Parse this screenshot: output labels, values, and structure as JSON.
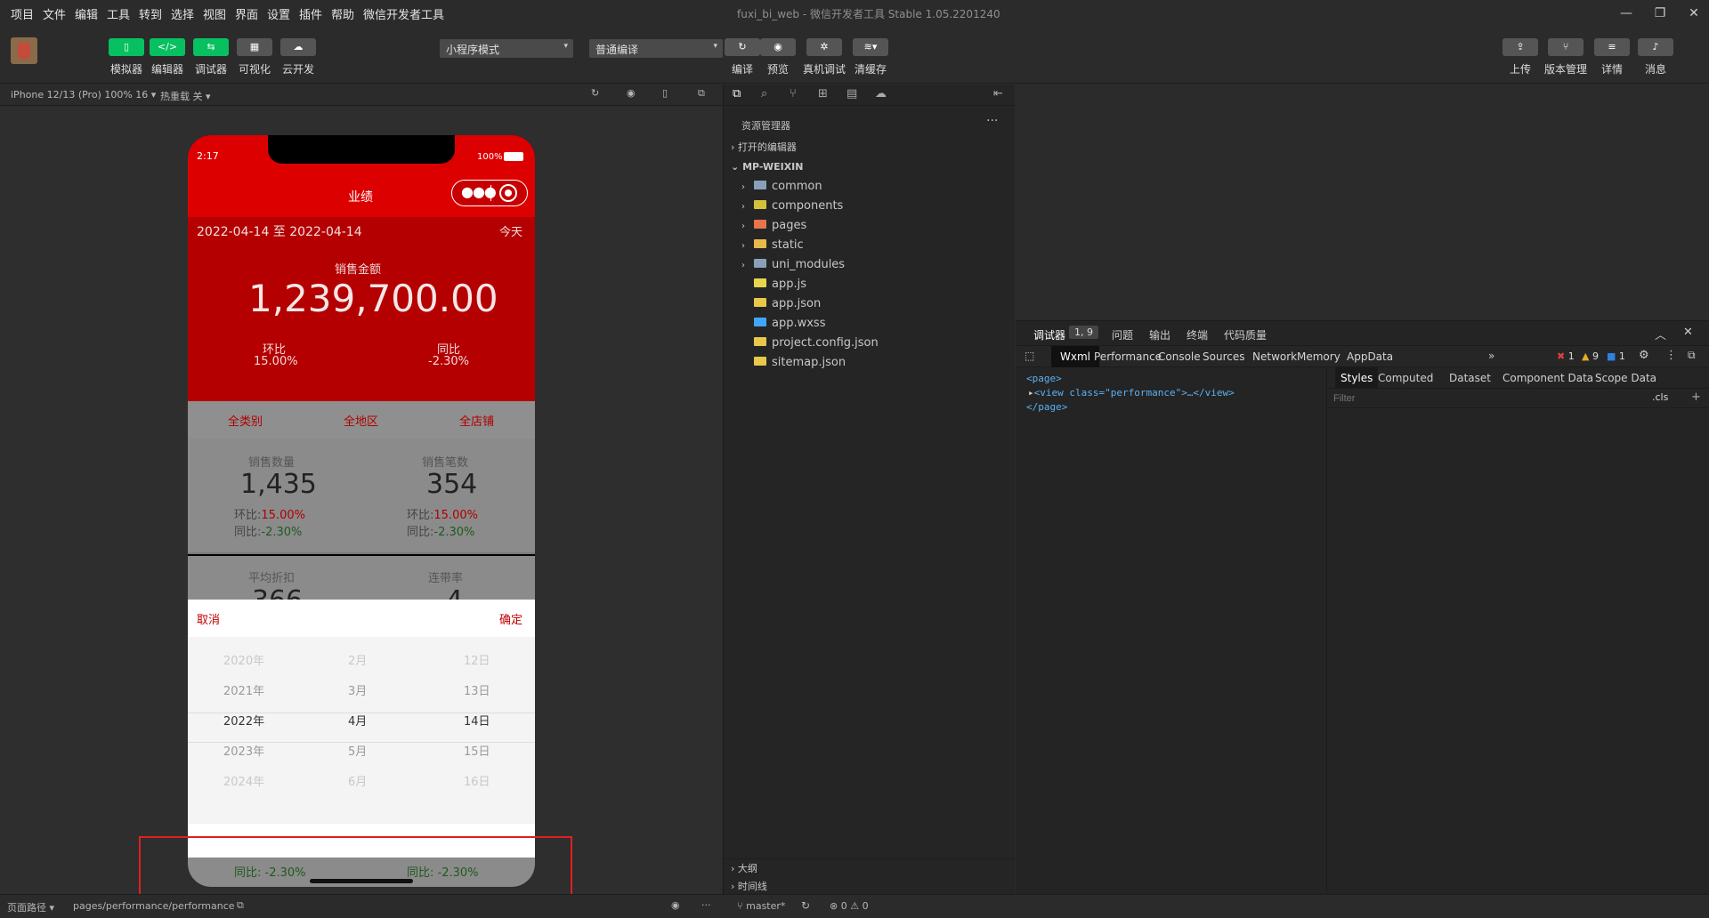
{
  "menubar": {
    "items": [
      "项目",
      "文件",
      "编辑",
      "工具",
      "转到",
      "选择",
      "视图",
      "界面",
      "设置",
      "插件",
      "帮助",
      "微信开发者工具"
    ],
    "title": "fuxi_bi_web - 微信开发者工具 Stable 1.05.2201240"
  },
  "toolbar": {
    "left": [
      {
        "label": "模拟器"
      },
      {
        "label": "编辑器"
      },
      {
        "label": "调试器"
      },
      {
        "label": "可视化"
      },
      {
        "label": "云开发"
      }
    ],
    "mode_select": "小程序模式",
    "compile_select": "普通编译",
    "middle": [
      {
        "label": "编译"
      },
      {
        "label": "预览"
      },
      {
        "label": "真机调试"
      },
      {
        "label": "清缓存"
      }
    ],
    "right": [
      {
        "label": "上传"
      },
      {
        "label": "版本管理"
      },
      {
        "label": "详情"
      },
      {
        "label": "消息"
      }
    ]
  },
  "sim": {
    "device": "iPhone 12/13 (Pro) 100% 16 ▾",
    "hotreload": "热重载 关 ▾"
  },
  "phone": {
    "time": "2:17",
    "battery": "100%",
    "nav_title": "业绩",
    "date_range": "2022-04-14 至 2022-04-14",
    "today": "今天",
    "sales_label": "销售金额",
    "sales_value": "1,239,700.00",
    "hb_label": "环比",
    "hb_value": "15.00%",
    "tb_label": "同比",
    "tb_value": "-2.30%",
    "filters": [
      "全类别",
      "全地区",
      "全店铺"
    ],
    "cards": [
      {
        "title": "销售数量",
        "value": "1,435",
        "hb": "15.00%",
        "tb": "-2.30%"
      },
      {
        "title": "销售笔数",
        "value": "354",
        "hb": "15.00%",
        "tb": "-2.30%"
      }
    ],
    "hb_prefix": "环比:",
    "tb_prefix": "同比:",
    "card2_titles": [
      "平均折扣",
      "连带率"
    ],
    "card2_values": [
      "366",
      "4"
    ],
    "picker": {
      "cancel": "取消",
      "confirm": "确定",
      "rows": [
        [
          "2020年",
          "2月",
          "12日"
        ],
        [
          "2021年",
          "3月",
          "13日"
        ],
        [
          "2022年",
          "4月",
          "14日"
        ],
        [
          "2023年",
          "5月",
          "15日"
        ],
        [
          "2024年",
          "6月",
          "16日"
        ]
      ]
    },
    "bottom": {
      "tb1": "同比: -2.30%",
      "tb2": "同比: -2.30%"
    }
  },
  "explorer": {
    "title": "资源管理器",
    "open_editors": "打开的编辑器",
    "root": "MP-WEIXIN",
    "items": [
      {
        "name": "common",
        "icon": "folder-icon",
        "color": "#8aa0b8"
      },
      {
        "name": "components",
        "icon": "folder-icon",
        "color": "#d3c23a"
      },
      {
        "name": "pages",
        "icon": "folder-icon",
        "color": "#e8744a"
      },
      {
        "name": "static",
        "icon": "folder-icon",
        "color": "#e8b84a"
      },
      {
        "name": "uni_modules",
        "icon": "folder-icon",
        "color": "#8aa0b8"
      },
      {
        "name": "app.js",
        "icon": "js-file-icon",
        "color": "#e8d44d"
      },
      {
        "name": "app.json",
        "icon": "json-file-icon",
        "color": "#e8c84a"
      },
      {
        "name": "app.wxss",
        "icon": "wxss-file-icon",
        "color": "#42a5f5"
      },
      {
        "name": "project.config.json",
        "icon": "json-file-icon",
        "color": "#e8c84a"
      },
      {
        "name": "sitemap.json",
        "icon": "json-file-icon",
        "color": "#e8c84a"
      }
    ],
    "outline": "大纲",
    "timeline": "时间线"
  },
  "devtools": {
    "top_tabs": [
      "调试器",
      "问题",
      "输出",
      "终端",
      "代码质量"
    ],
    "badge": "1, 9",
    "panel_tabs": [
      "Wxml",
      "Performance",
      "Console",
      "Sources",
      "Network",
      "Memory",
      "AppData"
    ],
    "errors": "1",
    "warnings": "9",
    "infos": "1",
    "code": [
      "<page>",
      "<view class=\"performance\">…</view>",
      "</page>"
    ],
    "style_tabs": [
      "Styles",
      "Computed",
      "Dataset",
      "Component Data",
      "Scope Data"
    ],
    "filter_placeholder": "Filter",
    "cls": ".cls"
  },
  "status": {
    "path_label": "页面路径 ▾",
    "path": "pages/performance/performance",
    "branch": "master*",
    "problems": "0",
    "warnings": "0"
  }
}
